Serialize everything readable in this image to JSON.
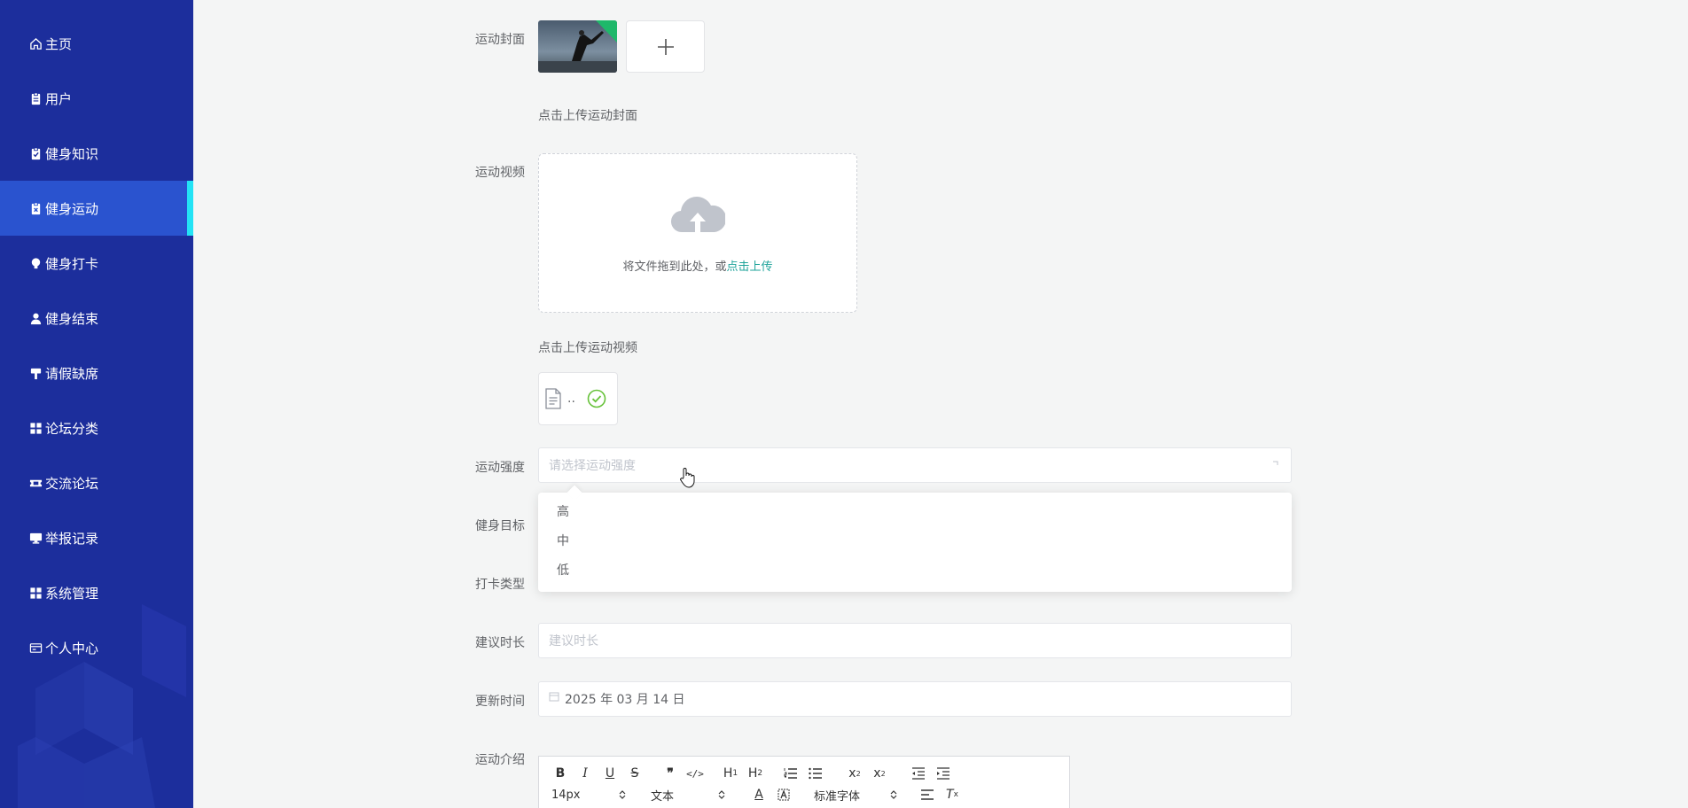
{
  "sidebar": {
    "items": [
      {
        "label": "主页",
        "icon": "home-icon"
      },
      {
        "label": "用户",
        "icon": "clipboard-icon"
      },
      {
        "label": "健身知识",
        "icon": "clipboard-check-icon"
      },
      {
        "label": "健身运动",
        "icon": "clipboard-x-icon",
        "active": true
      },
      {
        "label": "健身打卡",
        "icon": "lightbulb-icon"
      },
      {
        "label": "健身结束",
        "icon": "user-icon"
      },
      {
        "label": "请假缺席",
        "icon": "paint-roller-icon"
      },
      {
        "label": "论坛分类",
        "icon": "grid-icon"
      },
      {
        "label": "交流论坛",
        "icon": "ticket-icon"
      },
      {
        "label": "举报记录",
        "icon": "monitor-icon"
      },
      {
        "label": "系统管理",
        "icon": "grid-icon"
      },
      {
        "label": "个人中心",
        "icon": "id-card-icon"
      }
    ]
  },
  "form": {
    "cover": {
      "label": "运动封面",
      "hint": "点击上传运动封面"
    },
    "video": {
      "label": "运动视频",
      "drop_text": "将文件拖到此处，或",
      "drop_link": "点击上传",
      "hint": "点击上传运动视频",
      "file_name": ".."
    },
    "intensity": {
      "label": "运动强度",
      "placeholder": "请选择运动强度",
      "options": [
        "高",
        "中",
        "低"
      ]
    },
    "goal": {
      "label": "健身目标"
    },
    "checkin_type": {
      "label": "打卡类型"
    },
    "duration": {
      "label": "建议时长",
      "placeholder": "建议时长"
    },
    "updated": {
      "label": "更新时间",
      "value": "2025 年 03 月 14 日"
    },
    "intro": {
      "label": "运动介绍"
    }
  },
  "editor": {
    "font_size": "14px",
    "block_type": "文本",
    "font_family": "标准字体"
  },
  "colors": {
    "sidebar_bg": "#1c2e9c",
    "sidebar_active": "#2a53cf",
    "active_indicator": "#23e3f5",
    "link": "#1ea39a",
    "success": "#67c23a"
  }
}
